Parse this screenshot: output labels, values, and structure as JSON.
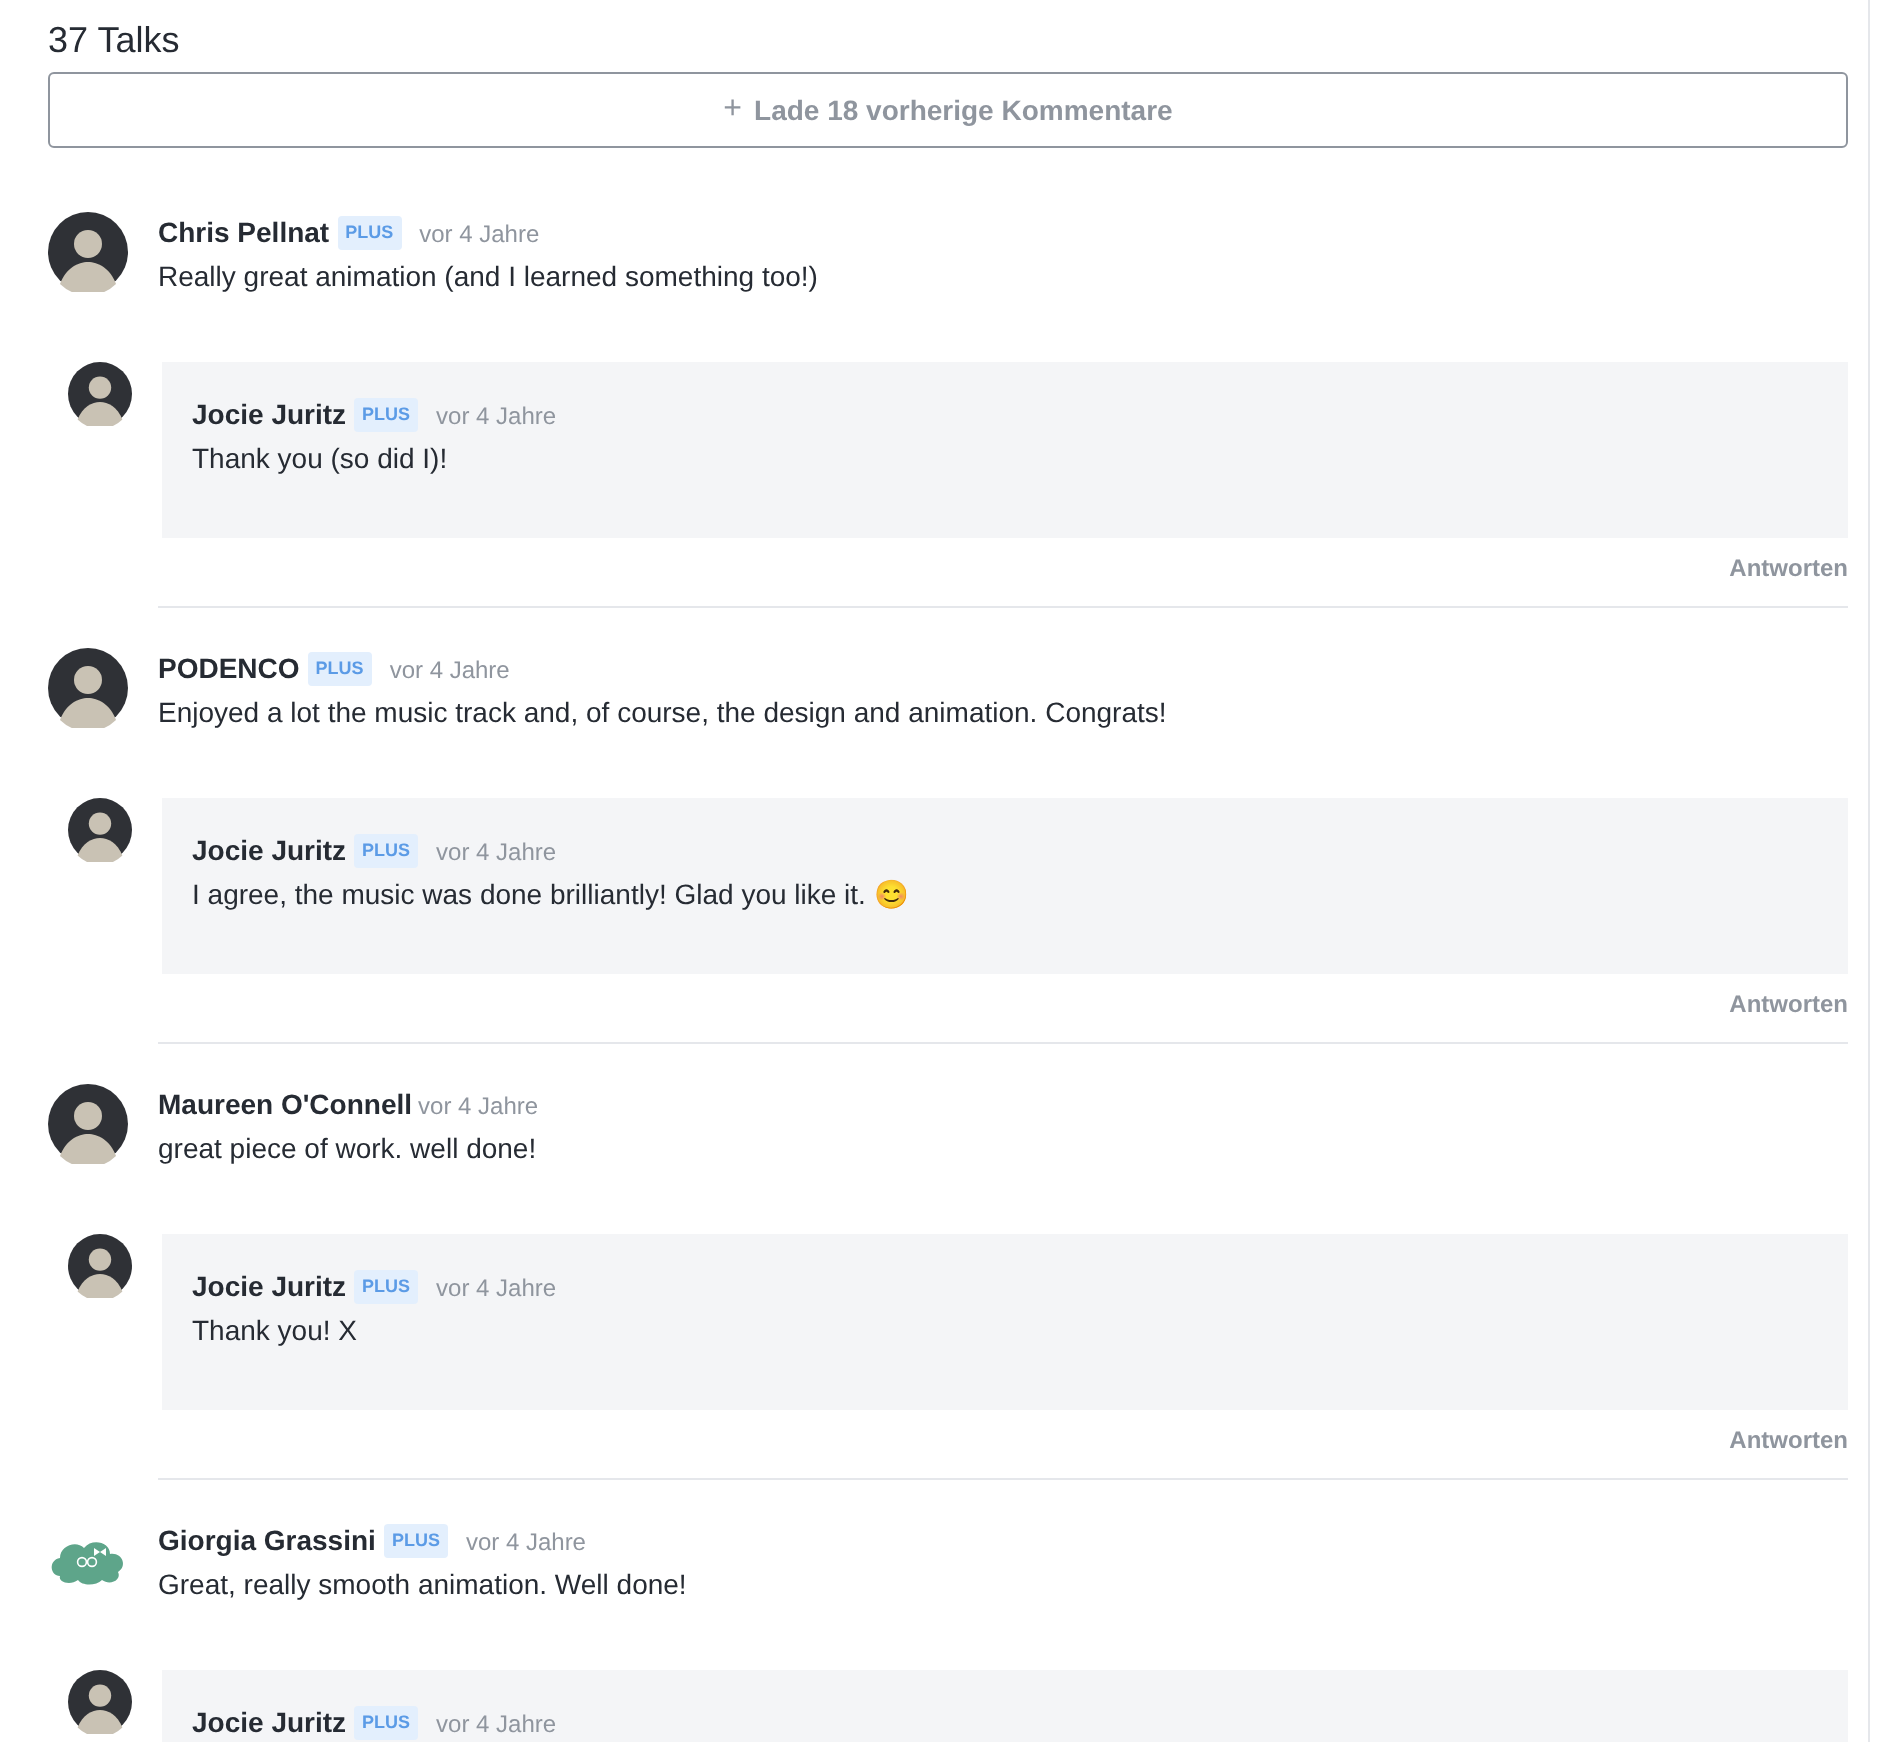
{
  "heading": "37 Talks",
  "load_more": {
    "icon": "+",
    "label": "Lade 18 vorherige Kommentare"
  },
  "comments": [
    {
      "author": "Chris Pellnat",
      "badge": "PLUS",
      "time": "vor 4 Jahre",
      "text": "Really great animation (and I learned something too!)",
      "avatar": {
        "kind": "photo"
      },
      "reply": {
        "author": "Jocie Juritz",
        "badge": "PLUS",
        "time": "vor 4 Jahre",
        "text": "Thank you (so did I)!",
        "action": "Antworten"
      }
    },
    {
      "author": "PODENCO",
      "badge": "PLUS",
      "time": "vor 4 Jahre",
      "text": "Enjoyed a lot the music track and, of course, the design and animation. Congrats!",
      "avatar": {
        "kind": "photo"
      },
      "reply": {
        "author": "Jocie Juritz",
        "badge": "PLUS",
        "time": "vor 4 Jahre",
        "text": "I agree, the music was done brilliantly! Glad you like it. 😊",
        "action": "Antworten"
      }
    },
    {
      "author": "Maureen O'Connell",
      "time": "vor 4 Jahre",
      "text": "great piece of work. well done!",
      "avatar": {
        "kind": "photo"
      },
      "reply": {
        "author": "Jocie Juritz",
        "badge": "PLUS",
        "time": "vor 4 Jahre",
        "text": "Thank you! X",
        "action": "Antworten"
      }
    },
    {
      "author": "Giorgia Grassini",
      "badge": "PLUS",
      "time": "vor 4 Jahre",
      "text": "Great, really smooth animation. Well done!",
      "avatar": {
        "kind": "logo"
      },
      "reply": {
        "author": "Jocie Juritz",
        "badge": "PLUS",
        "time": "vor 4 Jahre"
      }
    }
  ]
}
